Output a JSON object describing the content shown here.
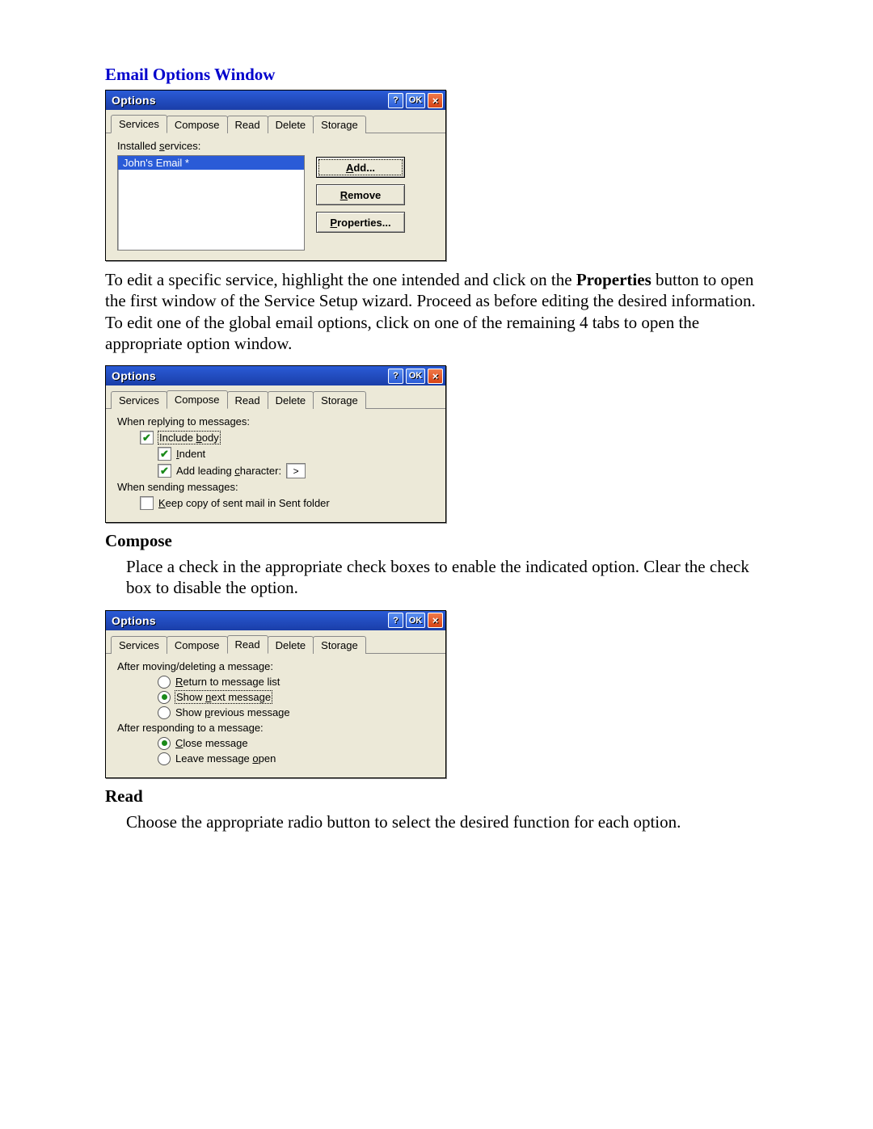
{
  "headings": {
    "main": "Email Options Window",
    "compose": "Compose",
    "read": "Read"
  },
  "paragraphs": {
    "p1a": "To edit a specific service, highlight the one intended and click on the ",
    "p1b": "Properties",
    "p1c": " button to open the first window of the Service Setup wizard.  Proceed as before editing the desired information.  To edit one of the global email options, click on one of the remaining 4 tabs to open the appropriate option window.",
    "compose": "Place a check in the appropriate check boxes to enable the indicated option.  Clear the check box to disable the option.",
    "read": "Choose the appropriate radio button to select the desired function for each option."
  },
  "window": {
    "title": "Options",
    "help": "?",
    "ok": "OK",
    "close": "×"
  },
  "tabs": {
    "services": "Services",
    "compose": "Compose",
    "read": "Read",
    "delete": "Delete",
    "storage": "Storage"
  },
  "services_pane": {
    "label_pre": "Installed ",
    "label_u": "s",
    "label_post": "ervices:",
    "item": "John's Email *",
    "btn_add": "dd...",
    "btn_add_u": "A",
    "btn_remove": "emove",
    "btn_remove_u": "R",
    "btn_props": "roperties...",
    "btn_props_u": "P"
  },
  "compose_pane": {
    "label_reply": "When replying to messages:",
    "include_pre": "Include ",
    "include_u": "b",
    "include_post": "ody",
    "indent_u": "I",
    "indent_post": "ndent",
    "leading_pre": "Add leading ",
    "leading_u": "c",
    "leading_post": "haracter:",
    "leading_value": ">",
    "label_send": "When sending messages:",
    "keep_u": "K",
    "keep_post": "eep copy of sent mail in Sent folder"
  },
  "read_pane": {
    "label_move": "After moving/deleting a message:",
    "r1_u": "R",
    "r1_post": "eturn to message list",
    "r2_pre": "Show ",
    "r2_u": "n",
    "r2_post": "ext message",
    "r3_pre": "Show ",
    "r3_u": "p",
    "r3_post": "revious message",
    "label_respond": "After responding to a message:",
    "r4_u": "C",
    "r4_post": "lose message",
    "r5_pre": "Leave message ",
    "r5_u": "o",
    "r5_post": "pen"
  }
}
